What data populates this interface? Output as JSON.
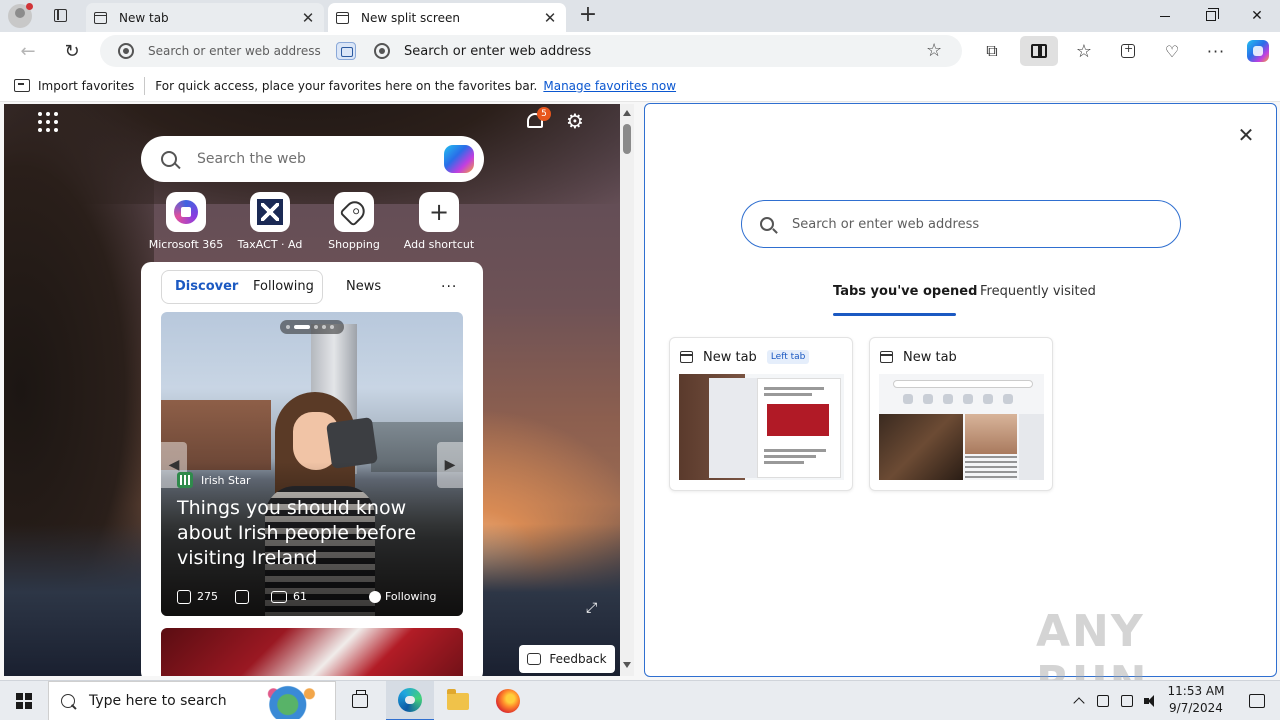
{
  "browser": {
    "tabs": [
      {
        "label": "New tab",
        "active": false
      },
      {
        "label": "New split screen",
        "active": true
      }
    ],
    "window_controls": {
      "minimize": "—",
      "restore": "❐",
      "close": "✕"
    }
  },
  "toolbar": {
    "address_left_placeholder": "Search or enter web address",
    "address_right_placeholder": "Search or enter web address",
    "icons": [
      "back-icon",
      "refresh-icon",
      "favorite-star-icon",
      "extensions-icon",
      "split-screen-icon",
      "favorites-icon",
      "collections-icon",
      "browser-essentials-icon",
      "more-icon",
      "copilot-icon"
    ]
  },
  "favorites_bar": {
    "import_label": "Import favorites",
    "hint": "For quick access, place your favorites here on the favorites bar.",
    "manage_link": "Manage favorites now"
  },
  "left_pane": {
    "notification_count": "5",
    "search_placeholder": "Search the web",
    "shortcuts": [
      {
        "label": "Microsoft 365",
        "icon": "microsoft-365-icon"
      },
      {
        "label": "TaxACT · Ad",
        "icon": "taxact-icon"
      },
      {
        "label": "Shopping",
        "icon": "shopping-tag-icon"
      },
      {
        "label": "Add shortcut",
        "icon": "plus-icon"
      }
    ],
    "feed_tabs": [
      "Discover",
      "Following",
      "News",
      "···"
    ],
    "story": {
      "source": "Irish Star",
      "headline": "Things you should know about Irish people before visiting Ireland",
      "likes": "275",
      "comments": "61",
      "follow_label": "Following"
    },
    "feedback_label": "Feedback"
  },
  "right_pane": {
    "search_placeholder": "Search or enter web address",
    "tabs": [
      "Tabs you've opened",
      "Frequently visited"
    ],
    "cards": [
      {
        "title": "New tab",
        "badge": "Left tab"
      },
      {
        "title": "New tab",
        "badge": ""
      }
    ]
  },
  "watermark": "ANY RUN",
  "taskbar": {
    "search_placeholder": "Type here to search",
    "time": "11:53 AM",
    "date": "9/7/2024"
  },
  "colors": {
    "accent": "#2f6fd0",
    "tabstrip": "#dfe3e8",
    "notification_badge": "#e8561d"
  }
}
